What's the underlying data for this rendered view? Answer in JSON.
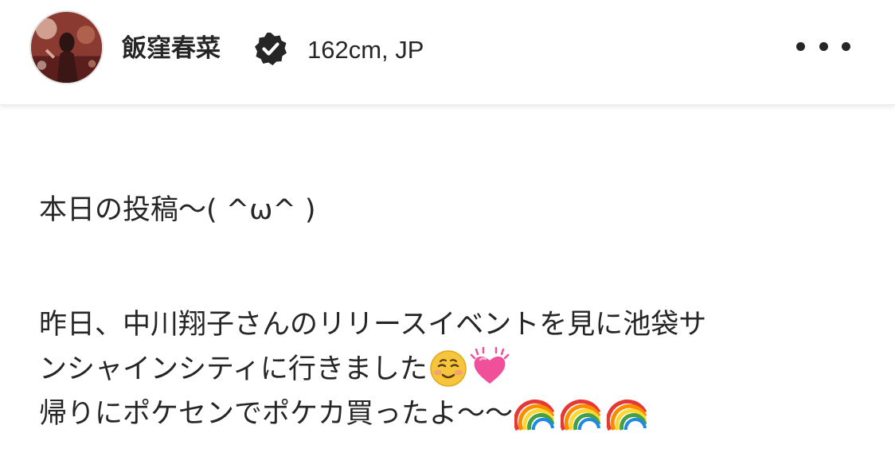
{
  "header": {
    "username": "飯窪春菜",
    "subtitle": "162cm, JP",
    "verified_icon": "verified-badge-icon",
    "more_icon": "more-horizontal-icon"
  },
  "post": {
    "caption_lines": [
      "本日の投稿〜( ^ω^ )",
      "",
      "昨日、中川翔子さんのリリースイベントを見に池袋サ",
      "ンシャインシティに行きました",
      "帰りにポケセンでポケカ買ったよ〜〜"
    ],
    "line4_emojis": [
      "smiling-face-icon",
      "beating-heart-icon"
    ],
    "line5_emojis": [
      "rainbow-icon",
      "rainbow-icon",
      "rainbow-icon"
    ]
  },
  "colors": {
    "text": "#262626",
    "verified": "#262626",
    "background": "#ffffff"
  }
}
